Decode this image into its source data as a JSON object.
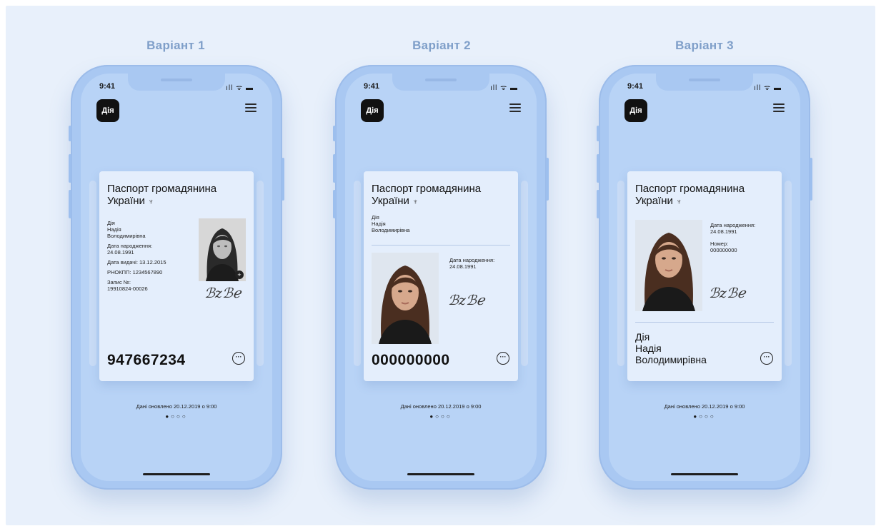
{
  "variants": [
    {
      "title": "Варіант 1",
      "time": "9:41",
      "status": "ıll ᯤ ▬",
      "logo": "Дія",
      "card_title": "Паспорт громадянина України",
      "trident": "♆",
      "name_lines": [
        "Дія",
        "Надія",
        "Володимирівна"
      ],
      "birth_label": "Дата народження:",
      "birth_value": "24.08.1991",
      "issue": "Дата видачі: 13.12.2015",
      "tax": "РНОКПП: 1234567890",
      "record_label": "Запис №:",
      "record_value": "19910824-00026",
      "number": "947667234",
      "more": "···",
      "updated": "Дані оновлено 20.12.2019 о 9:00",
      "dots": "●○○○"
    },
    {
      "title": "Варіант 2",
      "time": "9:41",
      "status": "ıll ᯤ ▬",
      "logo": "Дія",
      "card_title": "Паспорт громадянина України",
      "trident": "♆",
      "name_lines": [
        "Дія",
        "Надія",
        "Володимирівна"
      ],
      "birth_label": "Дата народження:",
      "birth_value": "24.08.1991",
      "number": "000000000",
      "more": "···",
      "updated": "Дані оновлено 20.12.2019 о 9:00",
      "dots": "●○○○"
    },
    {
      "title": "Варіант 3",
      "time": "9:41",
      "status": "ıll ᯤ ▬",
      "logo": "Дія",
      "card_title": "Паспорт громадянина України",
      "trident": "♆",
      "birth_label": "Дата народження:",
      "birth_value": "24.08.1991",
      "number_label": "Номер:",
      "number_value": "000000000",
      "name_lines": [
        "Дія",
        "Надія",
        "Володимирівна"
      ],
      "more": "···",
      "updated": "Дані оновлено 20.12.2019 о 9:00",
      "dots": "●○○○"
    }
  ],
  "colors": {
    "background": "#e8f0fb",
    "phone": "#a9c8f2",
    "screen": "#b8d3f6",
    "card": "#e4eefc",
    "title": "#7f9fc9"
  },
  "icons": {
    "logo": "diia-logo",
    "menu": "hamburger-icon",
    "more": "more-icon",
    "zoom": "zoom-in-icon"
  }
}
